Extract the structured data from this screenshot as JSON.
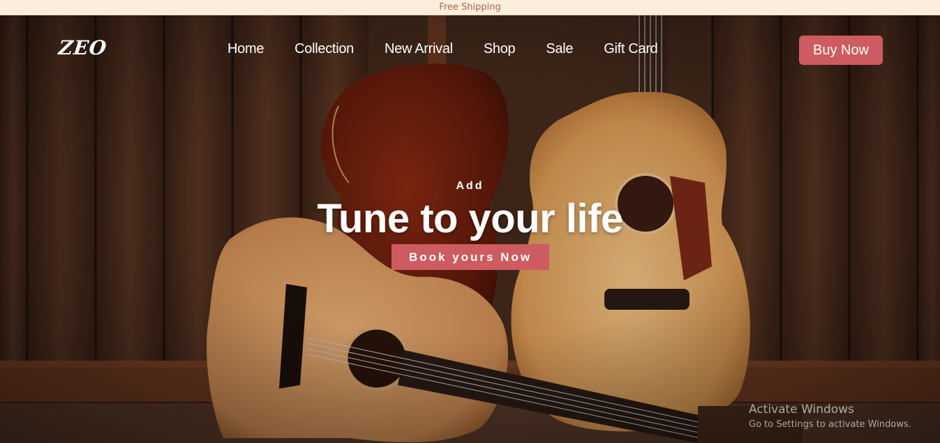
{
  "announcement": {
    "text": "Free Shipping"
  },
  "header": {
    "logo": "ZEO",
    "nav": [
      "Home",
      "Collection",
      "New Arrival",
      "Shop",
      "Sale",
      "Gift Card"
    ],
    "cta": "Buy Now"
  },
  "hero": {
    "kicker": "Add",
    "headline": "Tune to your life",
    "cta": "Book yours Now"
  },
  "watermark": {
    "title": "Activate Windows",
    "subtitle": "Go to Settings to activate Windows."
  },
  "colors": {
    "accent": "#cd5b5f",
    "announcement_bg": "#fbeedd",
    "announcement_text": "#b0634e",
    "wood_dark": "#3a2418"
  }
}
